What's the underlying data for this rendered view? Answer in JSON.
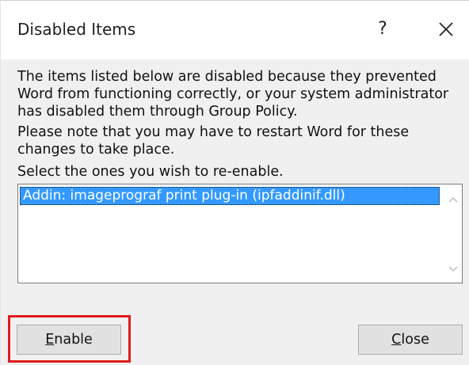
{
  "dialog": {
    "title": "Disabled Items",
    "help_label": "?",
    "close_icon": "close-icon"
  },
  "message": {
    "line1": "The items listed below are disabled because they prevented",
    "line2": "Word from functioning correctly, or your system administrator",
    "line3": "has disabled them through Group Policy.",
    "line4": "Please note that you may have to restart Word for these",
    "line5": "changes to take place.",
    "line6": "Select the ones you wish to re-enable."
  },
  "list": {
    "items": [
      {
        "label": "Addin: imageprograf print plug-in (ipfaddinif.dll)",
        "selected": true
      }
    ]
  },
  "buttons": {
    "enable_first": "E",
    "enable_rest": "nable",
    "close_first": "C",
    "close_rest": "lose"
  },
  "colors": {
    "selection": "#3399ff",
    "highlight_box": "#e21b1b"
  }
}
